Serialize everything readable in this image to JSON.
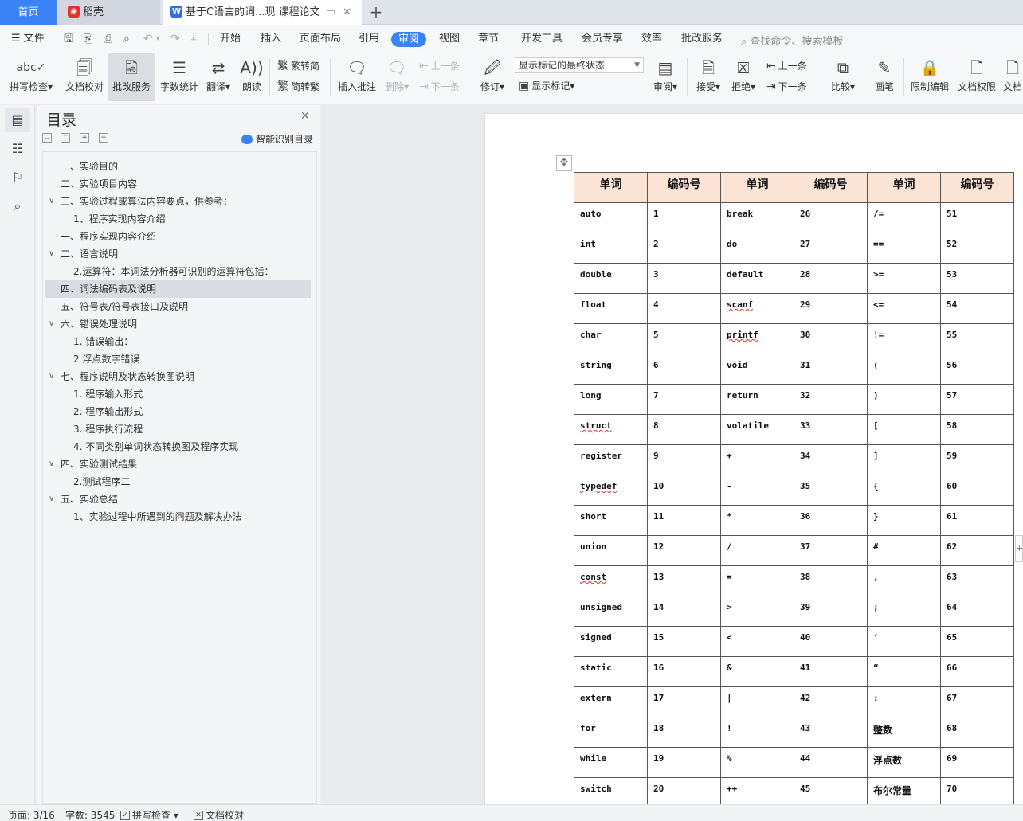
{
  "tabs": {
    "home": "首页",
    "daoke": "稻壳",
    "document": "基于C语言的词...现  课程论文"
  },
  "menu": {
    "file": "文件",
    "items": [
      "开始",
      "插入",
      "页面布局",
      "引用",
      "审阅",
      "视图",
      "章节",
      "开发工具",
      "会员专享",
      "效率",
      "批改服务"
    ],
    "active": "审阅",
    "search": "查找命令、搜索模板"
  },
  "ribbon": {
    "spellcheck": "拼写检查",
    "doc_proof": "文档校对",
    "grading": "批改服务",
    "word_count": "字数统计",
    "translate": "翻译",
    "read_aloud": "朗读",
    "to_simplified": "繁转简",
    "to_traditional": "简转繁",
    "insert_comment": "插入批注",
    "delete": "删除",
    "prev_comment": "上一条",
    "next_comment": "下一条",
    "track_changes": "修订",
    "markup_mode": "显示标记的最终状态",
    "show_markup": "显示标记",
    "review": "审阅",
    "accept": "接受",
    "reject": "拒绝",
    "prev_change": "上一条",
    "next_change": "下一条",
    "compare": "比较",
    "pen": "画笔",
    "restrict_edit": "限制编辑",
    "doc_permission": "文档权限",
    "doc_more": "文档"
  },
  "toc": {
    "title": "目录",
    "ai_label": "智能识别目录",
    "items": [
      {
        "label": "一、实验目的",
        "level": 1,
        "chev": false
      },
      {
        "label": "二、实验项目内容",
        "level": 1,
        "chev": false
      },
      {
        "label": "三、实验过程或算法内容要点，供参考：",
        "level": 1,
        "chev": true
      },
      {
        "label": "1、程序实现内容介绍",
        "level": 2,
        "chev": false
      },
      {
        "label": "一、程序实现内容介绍",
        "level": 1,
        "chev": false
      },
      {
        "label": "二、语言说明",
        "level": 1,
        "chev": true
      },
      {
        "label": "2.运算符：本词法分析器可识别的运算符包括：",
        "level": 2,
        "chev": false
      },
      {
        "label": "四、词法编码表及说明",
        "level": 1,
        "chev": false,
        "selected": true
      },
      {
        "label": "五、符号表/符号表接口及说明",
        "level": 1,
        "chev": false
      },
      {
        "label": "六、错误处理说明",
        "level": 1,
        "chev": true
      },
      {
        "label": "1.   错误输出：",
        "level": 2,
        "chev": false
      },
      {
        "label": "2  浮点数字错误",
        "level": 2,
        "chev": false
      },
      {
        "label": "七、程序说明及状态转换图说明",
        "level": 1,
        "chev": true
      },
      {
        "label": "1. 程序输入形式",
        "level": 2,
        "chev": false
      },
      {
        "label": "2. 程序输出形式",
        "level": 2,
        "chev": false
      },
      {
        "label": "3. 程序执行流程",
        "level": 2,
        "chev": false
      },
      {
        "label": "4. 不同类别单词状态转换图及程序实现",
        "level": 2,
        "chev": false
      },
      {
        "label": "四、实验测试结果",
        "level": 1,
        "chev": true
      },
      {
        "label": "2.测试程序二",
        "level": 2,
        "chev": false
      },
      {
        "label": "五、实验总结",
        "level": 1,
        "chev": true
      },
      {
        "label": "1、实验过程中所遇到的问题及解决办法",
        "level": 2,
        "chev": false
      }
    ]
  },
  "table": {
    "headers": [
      "单词",
      "编码号",
      "单词",
      "编码号",
      "单词",
      "编码号"
    ],
    "rows": [
      [
        "auto",
        "1",
        "break",
        "26",
        "/=",
        "51"
      ],
      [
        "int",
        "2",
        "do",
        "27",
        "==",
        "52"
      ],
      [
        "double",
        "3",
        "default",
        "28",
        ">=",
        "53"
      ],
      [
        "float",
        "4",
        "scanf",
        "29",
        "<=",
        "54"
      ],
      [
        "char",
        "5",
        "printf",
        "30",
        "!=",
        "55"
      ],
      [
        "string",
        "6",
        "void",
        "31",
        "(",
        "56"
      ],
      [
        "long",
        "7",
        "return",
        "32",
        ")",
        "57"
      ],
      [
        "struct",
        "8",
        "volatile",
        "33",
        "[",
        "58"
      ],
      [
        "register",
        "9",
        "+",
        "34",
        "]",
        "59"
      ],
      [
        "typedef",
        "10",
        "-",
        "35",
        "{",
        "60"
      ],
      [
        "short",
        "11",
        "*",
        "36",
        "}",
        "61"
      ],
      [
        "union",
        "12",
        "/",
        "37",
        "#",
        "62"
      ],
      [
        "const",
        "13",
        "=",
        "38",
        ",",
        "63"
      ],
      [
        "unsigned",
        "14",
        ">",
        "39",
        ";",
        "64"
      ],
      [
        "signed",
        "15",
        "<",
        "40",
        "‘",
        "65"
      ],
      [
        "static",
        "16",
        "&",
        "41",
        "“",
        "66"
      ],
      [
        "extern",
        "17",
        "|",
        "42",
        ":",
        "67"
      ],
      [
        "for",
        "18",
        "!",
        "43",
        "整数",
        "68"
      ],
      [
        "while",
        "19",
        "%",
        "44",
        "浮点数",
        "69"
      ],
      [
        "switch",
        "20",
        "++",
        "45",
        "布尔常量",
        "70"
      ]
    ],
    "squiggly_words": [
      "scanf",
      "printf",
      "struct",
      "typedef",
      "const"
    ]
  },
  "status": {
    "page": "页面: 3/16",
    "words": "字数: 3545",
    "spellcheck": "拼写检查",
    "doc_proof": "文档校对"
  },
  "colors": {
    "accent": "#3b82f6",
    "table_header_bg": "#fbe4d5",
    "toc_selected_bg": "#d9dce3"
  }
}
